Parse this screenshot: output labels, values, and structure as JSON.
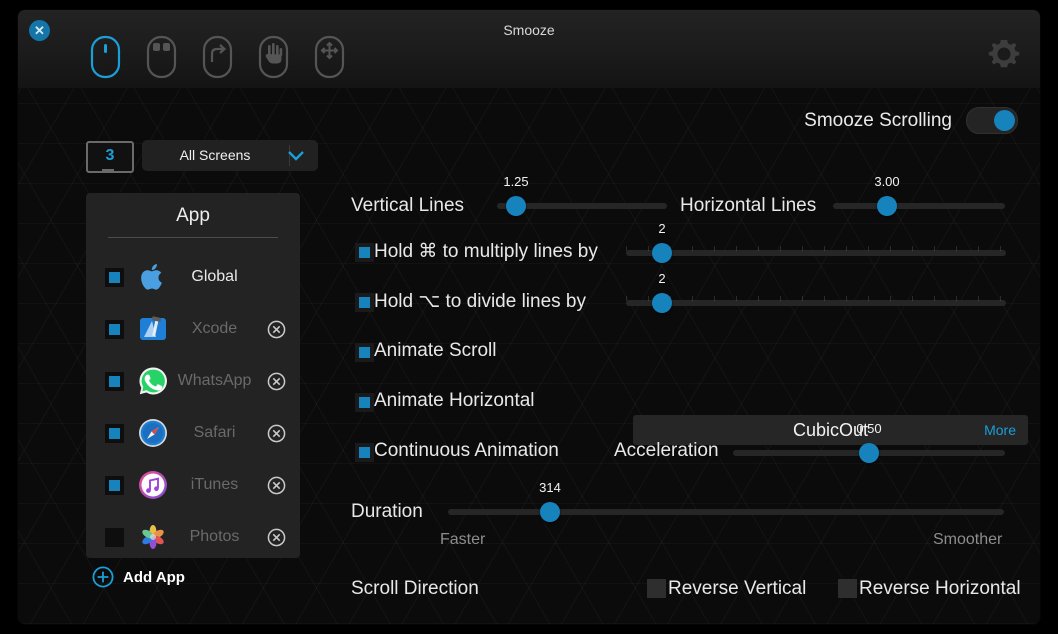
{
  "window": {
    "title": "Smooze",
    "close_icon": "close-icon",
    "gear_icon": "gear-icon"
  },
  "toolbar": {
    "items": [
      {
        "name": "mouse-scroll-icon",
        "selected": true
      },
      {
        "name": "mouse-buttons-icon",
        "selected": false
      },
      {
        "name": "mouse-gestures-icon",
        "selected": false
      },
      {
        "name": "mouse-hand-icon",
        "selected": false
      },
      {
        "name": "mouse-move-icon",
        "selected": false
      }
    ]
  },
  "master": {
    "label": "Smooze Scrolling",
    "enabled": true
  },
  "screens": {
    "count": "3",
    "selected": "All Screens",
    "chevron_icon": "chevron-down-icon"
  },
  "apps": {
    "header": "App",
    "add_label": "Add App",
    "add_icon": "plus-circle-icon",
    "items": [
      {
        "name": "Global",
        "icon": "apple-icon",
        "checked": true,
        "removable": false,
        "dim": false
      },
      {
        "name": "Xcode",
        "icon": "xcode-icon",
        "checked": true,
        "removable": true,
        "dim": true
      },
      {
        "name": "WhatsApp",
        "icon": "whatsapp-icon",
        "checked": true,
        "removable": true,
        "dim": true
      },
      {
        "name": "Safari",
        "icon": "safari-icon",
        "checked": true,
        "removable": true,
        "dim": true
      },
      {
        "name": "iTunes",
        "icon": "itunes-icon",
        "checked": true,
        "removable": true,
        "dim": true
      },
      {
        "name": "Photos",
        "icon": "photos-icon",
        "checked": false,
        "removable": true,
        "dim": true
      }
    ]
  },
  "settings": {
    "vertical_lines": {
      "label": "Vertical Lines",
      "value": "1.25",
      "pos": 0.04
    },
    "horizontal_lines": {
      "label": "Horizontal Lines",
      "value": "3.00",
      "pos": 0.22
    },
    "multiply": {
      "label": "Hold ⌘ to multiply lines by",
      "value": "2",
      "pos": 0.03,
      "checked": true
    },
    "divide": {
      "label": "Hold ⌥ to divide lines by",
      "value": "2",
      "pos": 0.03,
      "checked": true
    },
    "animate_scroll": {
      "label": "Animate Scroll",
      "checked": true
    },
    "animate_horizontal": {
      "label": "Animate Horizontal",
      "checked": true
    },
    "continuous_animation": {
      "label": "Continuous Animation",
      "checked": true
    },
    "easing": {
      "value": "CubicOut",
      "more_label": "More"
    },
    "acceleration": {
      "label": "Acceleration",
      "value": "0.50",
      "pos": 0.5
    },
    "duration": {
      "label": "Duration",
      "value": "314",
      "pos": 0.155,
      "min_hint": "Faster",
      "max_hint": "Smoother"
    },
    "scroll_direction": {
      "label": "Scroll Direction",
      "reverse_vertical": {
        "label": "Reverse Vertical",
        "checked": false
      },
      "reverse_horizontal": {
        "label": "Reverse Horizontal",
        "checked": false
      }
    }
  },
  "colors": {
    "accent": "#1783bd",
    "accent_text": "#1a9fd8",
    "panel": "#232323",
    "background": "#0b0b0b"
  }
}
